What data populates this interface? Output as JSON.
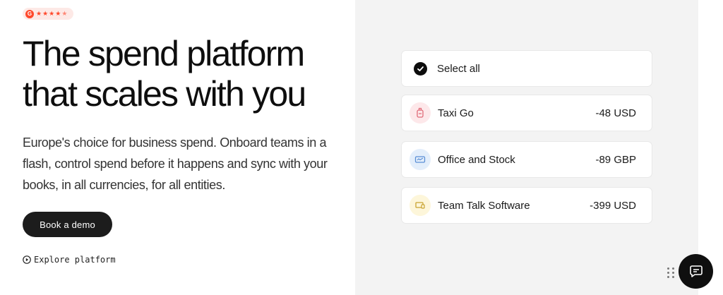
{
  "hero": {
    "rating_badge": {
      "logo": "G",
      "stars": [
        "★",
        "★",
        "★",
        "★",
        "★"
      ],
      "rating": 4.5
    },
    "title_line1": "The spend platform",
    "title_line2": "that scales with you",
    "subtitle": "Europe's choice for business spend. Onboard teams in a flash, control spend before it happens and sync with your books, in all currencies, for all entities.",
    "cta_label": "Book a demo",
    "explore_label": "Explore platform"
  },
  "expenses": {
    "select_all_label": "Select all",
    "items": [
      {
        "label": "Taxi Go",
        "amount": "-48 USD",
        "icon": "taxi-icon",
        "icon_bg": "#fde8ea"
      },
      {
        "label": "Office and Stock",
        "amount": "-89 GBP",
        "icon": "office-supplies-icon",
        "icon_bg": "#e3eefb"
      },
      {
        "label": "Team Talk Software",
        "amount": "-399 USD",
        "icon": "software-icon",
        "icon_bg": "#fdf6da"
      }
    ]
  },
  "colors": {
    "accent_g2": "#ff492c",
    "button_bg": "#1c1c1c",
    "panel_bg": "#f3f3f3"
  }
}
